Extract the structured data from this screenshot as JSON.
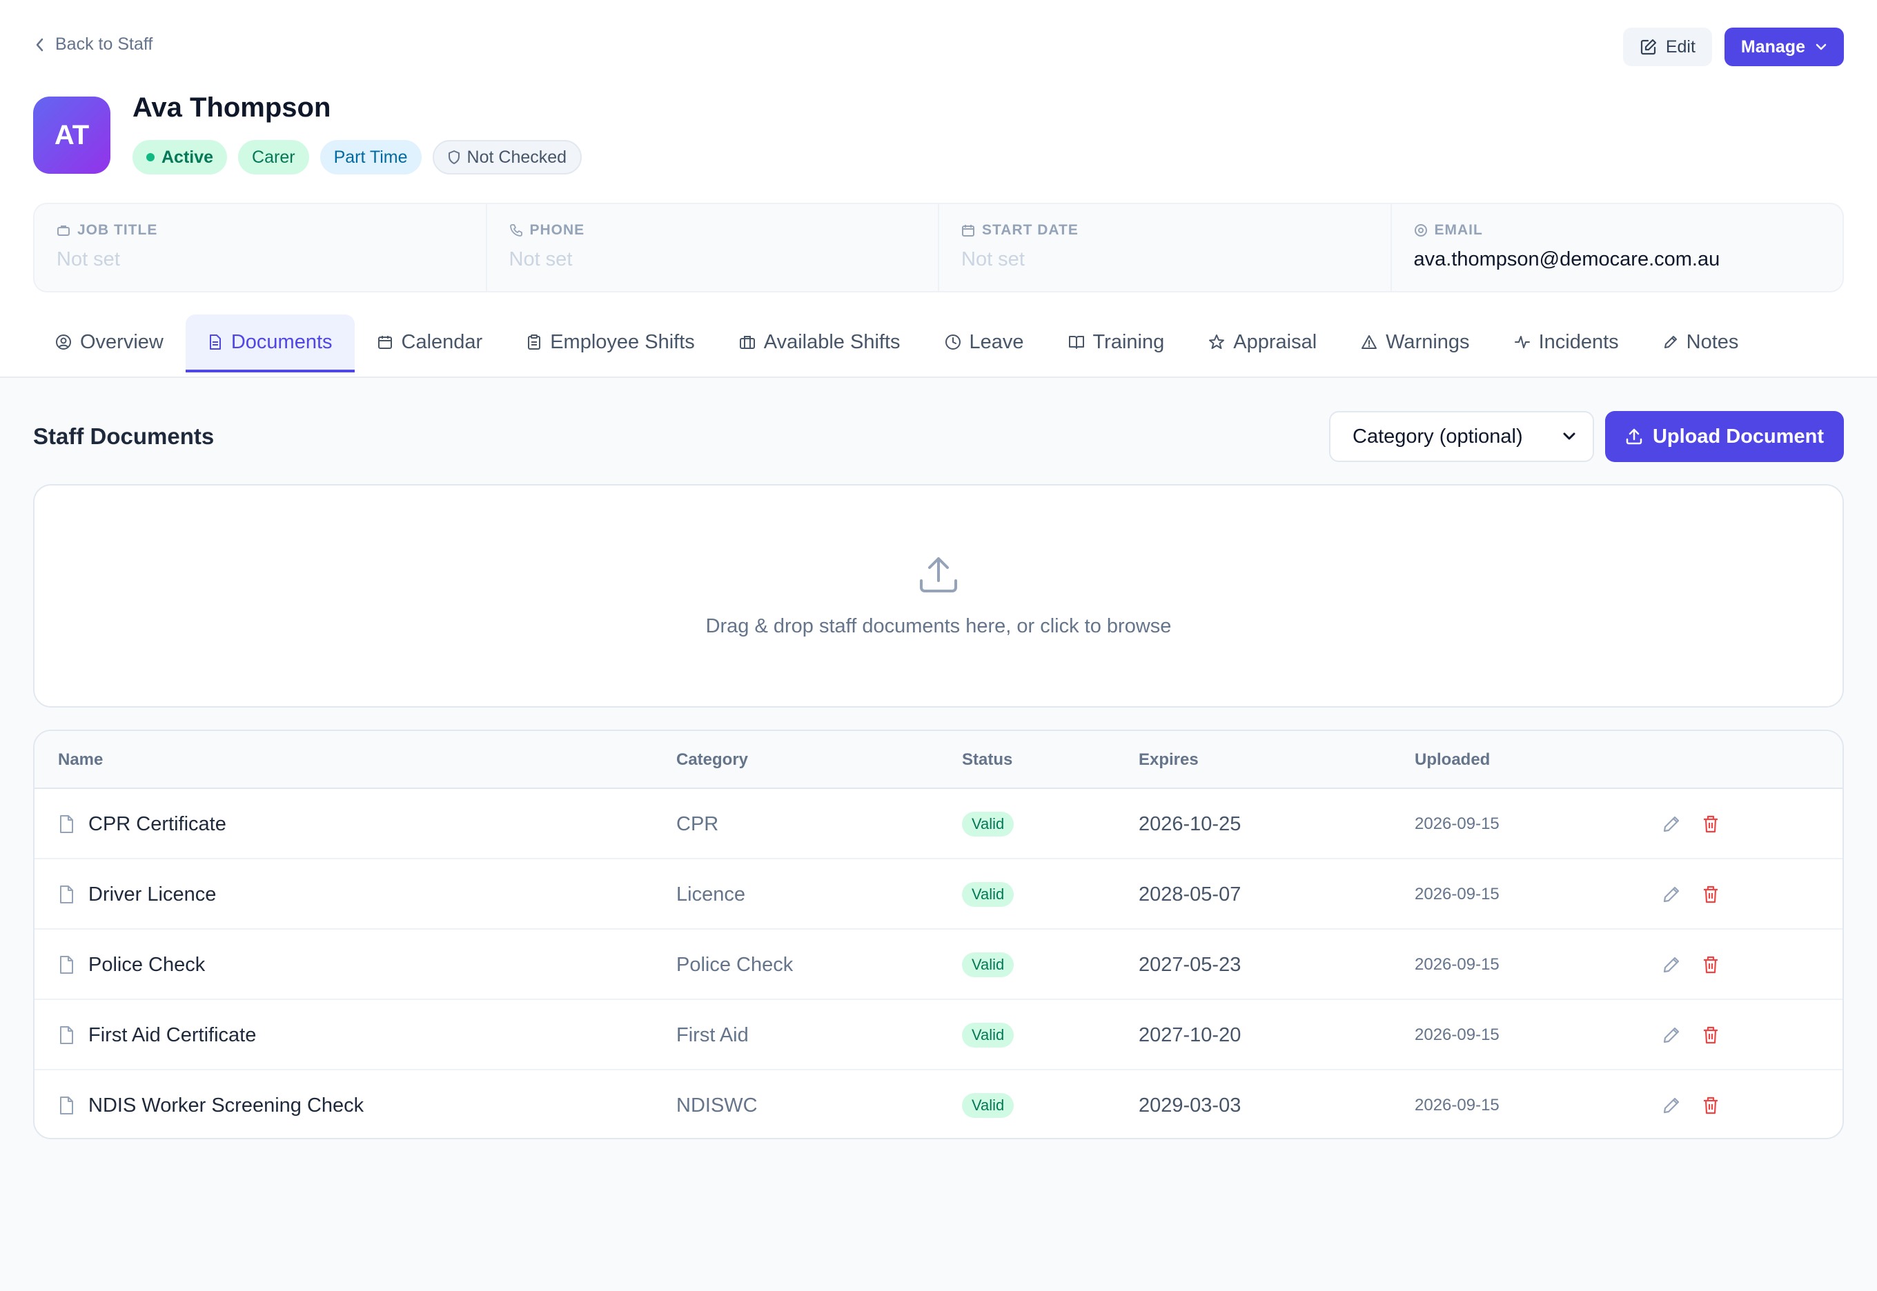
{
  "header": {
    "back_label": "Back to Staff",
    "edit_label": "Edit",
    "manage_label": "Manage"
  },
  "profile": {
    "initials": "AT",
    "name": "Ava Thompson",
    "badges": {
      "status": "Active",
      "role": "Carer",
      "employment": "Part Time",
      "check": "Not Checked"
    }
  },
  "info": [
    {
      "label": "JOB TITLE",
      "value": "Not set",
      "icon": "briefcase-icon"
    },
    {
      "label": "PHONE",
      "value": "Not set",
      "icon": "phone-icon"
    },
    {
      "label": "START DATE",
      "value": "Not set",
      "icon": "calendar-icon"
    },
    {
      "label": "EMAIL",
      "value": "ava.thompson@democare.com.au",
      "icon": "at-sign-icon"
    }
  ],
  "tabs": [
    {
      "label": "Overview",
      "icon": "user-circle-icon"
    },
    {
      "label": "Documents",
      "icon": "document-icon",
      "active": true
    },
    {
      "label": "Calendar",
      "icon": "calendar-icon"
    },
    {
      "label": "Employee Shifts",
      "icon": "clipboard-icon"
    },
    {
      "label": "Available Shifts",
      "icon": "briefcase-icon"
    },
    {
      "label": "Leave",
      "icon": "clock-icon"
    },
    {
      "label": "Training",
      "icon": "book-icon"
    },
    {
      "label": "Appraisal",
      "icon": "star-icon"
    },
    {
      "label": "Warnings",
      "icon": "warning-icon"
    },
    {
      "label": "Incidents",
      "icon": "activity-icon"
    },
    {
      "label": "Notes",
      "icon": "pen-icon"
    }
  ],
  "documents_section": {
    "title": "Staff Documents",
    "category_select": "Category (optional)",
    "upload_label": "Upload Document",
    "dropzone_text": "Drag & drop staff documents here, or click to browse"
  },
  "table": {
    "columns": [
      "Name",
      "Category",
      "Status",
      "Expires",
      "Uploaded"
    ],
    "rows": [
      {
        "name": "CPR Certificate",
        "category": "CPR",
        "status": "Valid",
        "expires": "2026-10-25",
        "uploaded": "2026-09-15"
      },
      {
        "name": "Driver Licence",
        "category": "Licence",
        "status": "Valid",
        "expires": "2028-05-07",
        "uploaded": "2026-09-15"
      },
      {
        "name": "Police Check",
        "category": "Police Check",
        "status": "Valid",
        "expires": "2027-05-23",
        "uploaded": "2026-09-15"
      },
      {
        "name": "First Aid Certificate",
        "category": "First Aid",
        "status": "Valid",
        "expires": "2027-10-20",
        "uploaded": "2026-09-15"
      },
      {
        "name": "NDIS Worker Screening Check",
        "category": "NDISWC",
        "status": "Valid",
        "expires": "2029-03-03",
        "uploaded": "2026-09-15"
      }
    ]
  },
  "colors": {
    "accent": "#4f46e5",
    "success_bg": "#d1fae5",
    "success_text": "#047857",
    "danger": "#ef4444"
  }
}
